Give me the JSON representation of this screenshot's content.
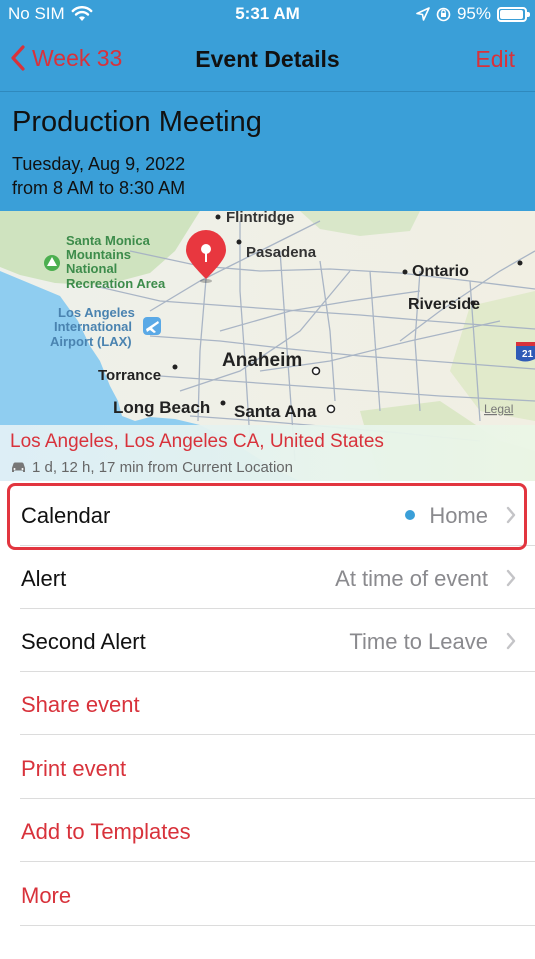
{
  "status_bar": {
    "carrier": "No SIM",
    "time": "5:31 AM",
    "battery": "95%",
    "battery_level": 0.95
  },
  "nav": {
    "back_label": "Week 33",
    "title": "Event Details",
    "edit_label": "Edit"
  },
  "event": {
    "title": "Production Meeting",
    "date": "Tuesday, Aug 9, 2022",
    "time_range": "from 8 AM to 8:30 AM"
  },
  "map": {
    "labels": {
      "flintridge": "Flintridge",
      "pasadena": "Pasadena",
      "santa_monica_1": "Santa Monica",
      "santa_monica_2": "Mountains",
      "santa_monica_3": "National",
      "santa_monica_4": "Recreation Area",
      "ontario": "Ontario",
      "riverside": "Riverside",
      "lax_1": "Los Angeles",
      "lax_2": "International",
      "lax_3": "Airport (LAX)",
      "anaheim": "Anaheim",
      "torrance": "Torrance",
      "long_beach": "Long Beach",
      "santa_ana": "Santa Ana",
      "legal": "Legal",
      "shield": "21"
    }
  },
  "location": {
    "name": "Los Angeles, Los Angeles CA, United States",
    "eta": "1 d, 12 h, 17 min from Current Location"
  },
  "rows": {
    "calendar": {
      "label": "Calendar",
      "value": "Home"
    },
    "alert": {
      "label": "Alert",
      "value": "At time of event"
    },
    "second_alert": {
      "label": "Second Alert",
      "value": "Time to Leave"
    },
    "share": {
      "label": "Share event"
    },
    "print": {
      "label": "Print event"
    },
    "templates": {
      "label": "Add to Templates"
    },
    "more": {
      "label": "More"
    }
  },
  "colors": {
    "accent": "#d8323b",
    "header_bg": "#3a9fd8",
    "calendar_dot": "#3a9fd8"
  }
}
